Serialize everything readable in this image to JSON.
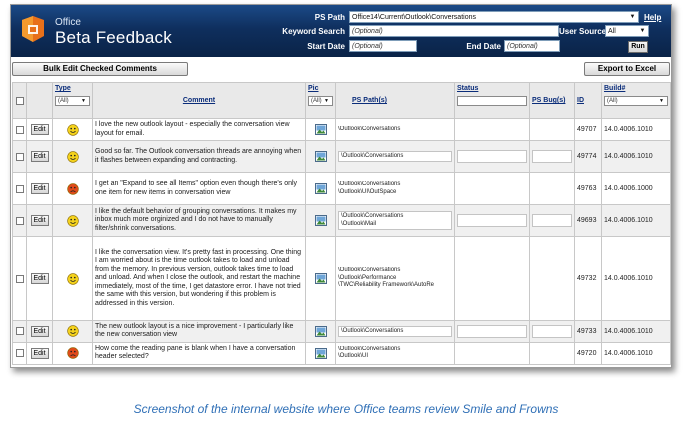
{
  "header": {
    "brand_small": "Office",
    "brand_big": "Beta Feedback",
    "ps_path_label": "PS Path",
    "ps_path_value": "Office14\\Current\\Outlook\\Conversations",
    "keyword_label": "Keyword Search",
    "keyword_placeholder": "(Optional)",
    "user_source_label": "User Source",
    "user_source_value": "All",
    "start_date_label": "Start Date",
    "start_date_placeholder": "(Optional)",
    "end_date_label": "End Date",
    "end_date_placeholder": "(Optional)",
    "help": "Help",
    "run": "Run"
  },
  "toolbar": {
    "bulk_edit": "Bulk Edit Checked Comments",
    "export": "Export to Excel"
  },
  "columns": {
    "type": "Type",
    "type_filter": "(All)",
    "comment": "Comment",
    "pic": "Pic",
    "pic_filter": "(All)",
    "ps_paths": "PS Path(s)",
    "status": "Status",
    "ps_bugs": "PS Bug(s)",
    "id": "ID",
    "build": "Build#",
    "build_filter": "(All)"
  },
  "edit_label": "Edit",
  "rows": [
    {
      "face": "smile",
      "comment": "I love the new outlook layout - especially the conversation view layout for email.",
      "paths": [
        "\\Outlook\\Conversations"
      ],
      "path_boxed": false,
      "fields": false,
      "id": "49707",
      "build": "14.0.4006.1010"
    },
    {
      "face": "smile",
      "comment": "Good so far. The Outlook conversation threads are annoying when it flashes between expanding and contracting.",
      "paths": [
        "\\Outlook\\Conversations"
      ],
      "path_boxed": true,
      "fields": true,
      "id": "49774",
      "build": "14.0.4006.1010"
    },
    {
      "face": "frown",
      "comment": "I get an \"Expand to see all Items\" option even though there's only one item for new items in conversation view",
      "paths": [
        "\\Outlook\\Conversations",
        "\\Outlook\\UI\\OutSpace"
      ],
      "path_boxed": false,
      "fields": false,
      "id": "49763",
      "build": "14.0.4006.1000"
    },
    {
      "face": "smile",
      "comment": "I like the default behavior of grouping conversations. It makes my inbox much more orginized and I do not have to manually filter/shrink conversations.",
      "paths": [
        "\\Outlook\\Conversations",
        "\\Outlook\\Mail"
      ],
      "path_boxed": true,
      "fields": true,
      "id": "49693",
      "build": "14.0.4006.1010"
    },
    {
      "face": "smile",
      "comment": "I like the conversation view. It's pretty fast in processing. One thing I am worried about is the time outlook takes to load and unload from the memory. In previous version, outlook takes time to load and unload. And when I close the outlook, and restart the machine immediately, most of the time, I get datastore error. I have not tried the same with this version, but wondering if this problem is addressed in this version.",
      "paths": [
        "\\Outlook\\Conversations",
        "\\Outlook\\Performance",
        "\\TWC\\Reliability Framework\\AutoRe"
      ],
      "path_boxed": false,
      "fields": false,
      "id": "49732",
      "build": "14.0.4006.1010"
    },
    {
      "face": "smile",
      "comment": "The new outlook layout is a nice improvement - I particularly like the new conversation view",
      "paths": [
        "\\Outlook\\Conversations"
      ],
      "path_boxed": true,
      "fields": true,
      "id": "49733",
      "build": "14.0.4006.1010"
    },
    {
      "face": "frown",
      "comment": "How come the reading pane is blank when I have a conversation header selected?",
      "paths": [
        "\\Outlook\\Conversations",
        "\\Outlook\\UI"
      ],
      "path_boxed": false,
      "fields": false,
      "id": "49720",
      "build": "14.0.4006.1010"
    }
  ],
  "caption": "Screenshot of the internal website where Office teams review Smile and Frowns",
  "colors": {
    "header": "#0f2f5e",
    "column_header_text": "#0b2d7a",
    "smile": "#f4d21c",
    "frown": "#e04a1a",
    "caption": "#2f6fb6"
  }
}
